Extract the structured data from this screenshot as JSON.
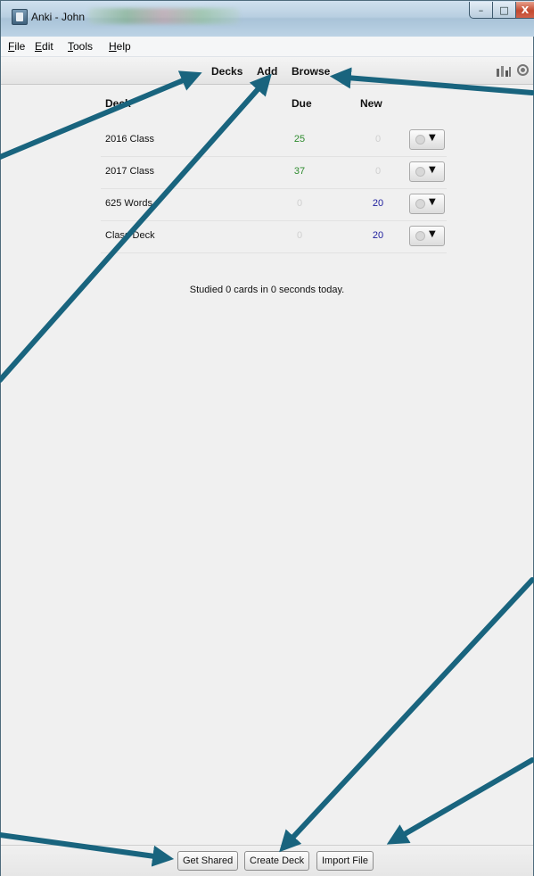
{
  "window": {
    "title": "Anki - John",
    "minimize_glyph": "–",
    "maximize_glyph": "□",
    "close_glyph": "X"
  },
  "menu": {
    "file": {
      "underline": "F",
      "rest": "ile"
    },
    "edit": {
      "underline": "E",
      "rest": "dit"
    },
    "tools": {
      "underline": "T",
      "rest": "ools"
    },
    "help": {
      "underline": "H",
      "rest": "elp"
    }
  },
  "toolbar": {
    "decks": "Decks",
    "add": "Add",
    "browse": "Browse",
    "stats_icon": "stats-icon",
    "sync_icon": "sync-icon"
  },
  "deck_list": {
    "headers": {
      "deck": "Deck",
      "due": "Due",
      "new": "New"
    },
    "rows": [
      {
        "name": "2016 Class",
        "due": "25",
        "new": "0"
      },
      {
        "name": "2017 Class",
        "due": "37",
        "new": "0"
      },
      {
        "name": "625 Words",
        "due": "0",
        "new": "20"
      },
      {
        "name": "Class Deck",
        "due": "0",
        "new": "20"
      }
    ],
    "gear_arrow": "▼",
    "studied": "Studied 0 cards in 0 seconds today."
  },
  "bottom": {
    "get_shared": "Get Shared",
    "create_deck": "Create Deck",
    "import_file": "Import File"
  },
  "colors": {
    "due_active": "#2e8b2e",
    "new_active": "#1c1c9c",
    "zero": "#d0d0d0",
    "annotation_arrow": "#19647e"
  }
}
